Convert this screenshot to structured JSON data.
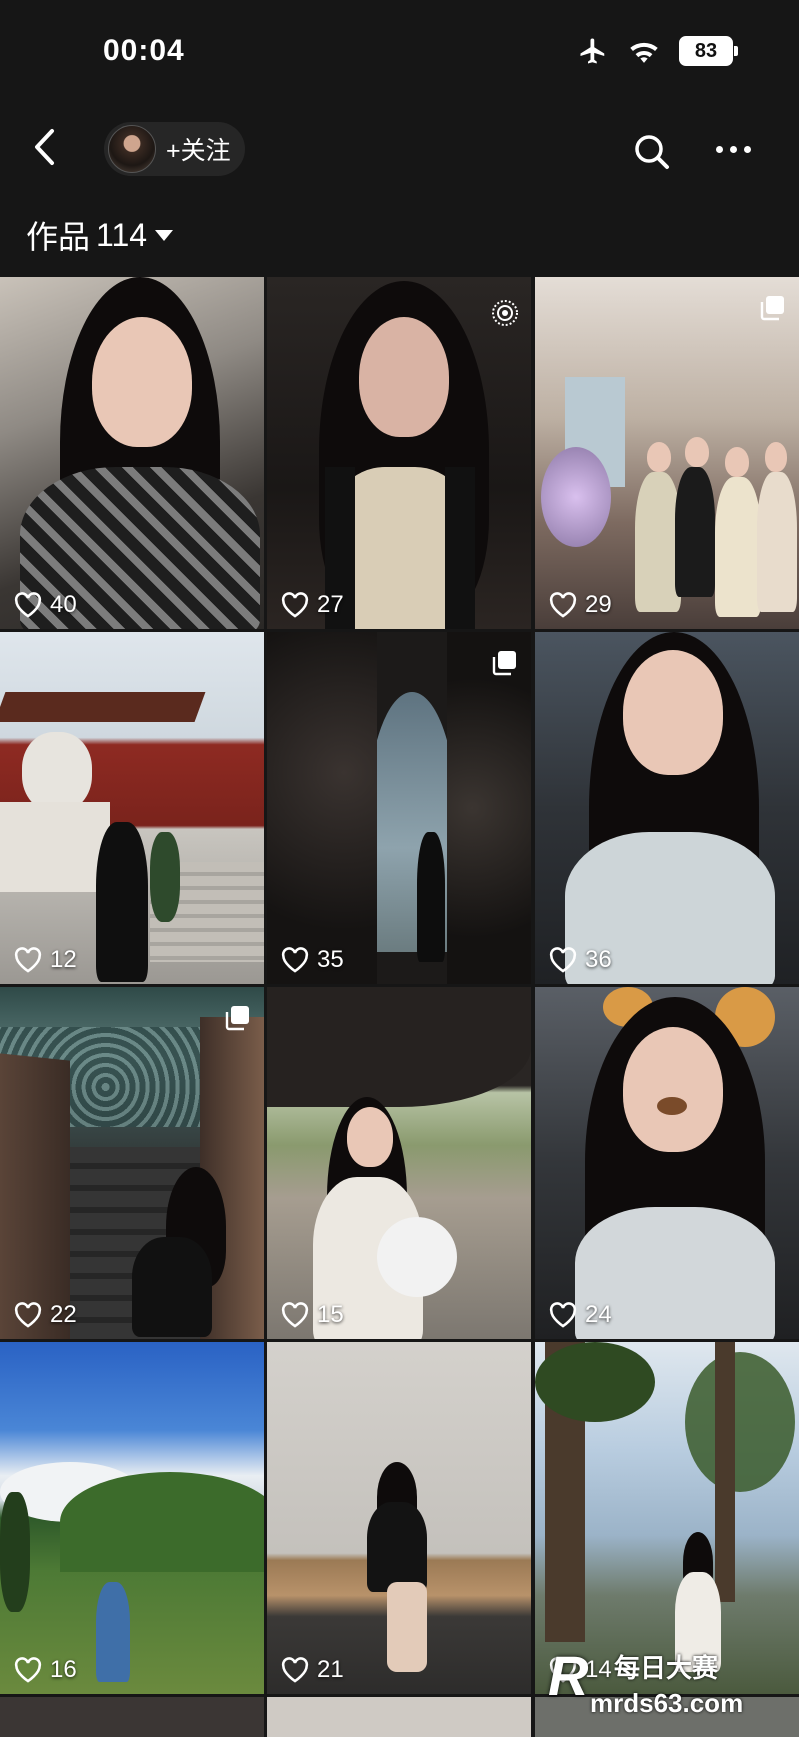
{
  "status_bar": {
    "time": "00:04",
    "battery": "83"
  },
  "nav": {
    "follow_label": "+关注"
  },
  "works": {
    "label": "作品",
    "count": "114"
  },
  "tiles": [
    {
      "likes": "40"
    },
    {
      "likes": "27"
    },
    {
      "likes": "29"
    },
    {
      "likes": "12"
    },
    {
      "likes": "35"
    },
    {
      "likes": "36"
    },
    {
      "likes": "22"
    },
    {
      "likes": "15"
    },
    {
      "likes": "24"
    },
    {
      "likes": "16"
    },
    {
      "likes": "21"
    },
    {
      "likes": "14"
    }
  ],
  "watermark": {
    "title": "每日大赛",
    "url": "mrds63.com"
  },
  "icons": [
    "airplane-icon",
    "wifi-icon",
    "battery-icon",
    "back-arrow-icon",
    "search-icon",
    "more-icon",
    "heart-icon",
    "multi-image-icon",
    "live-photo-icon"
  ],
  "colors": {
    "background": "#161616",
    "pill": "#262626",
    "text": "#ffffff"
  }
}
